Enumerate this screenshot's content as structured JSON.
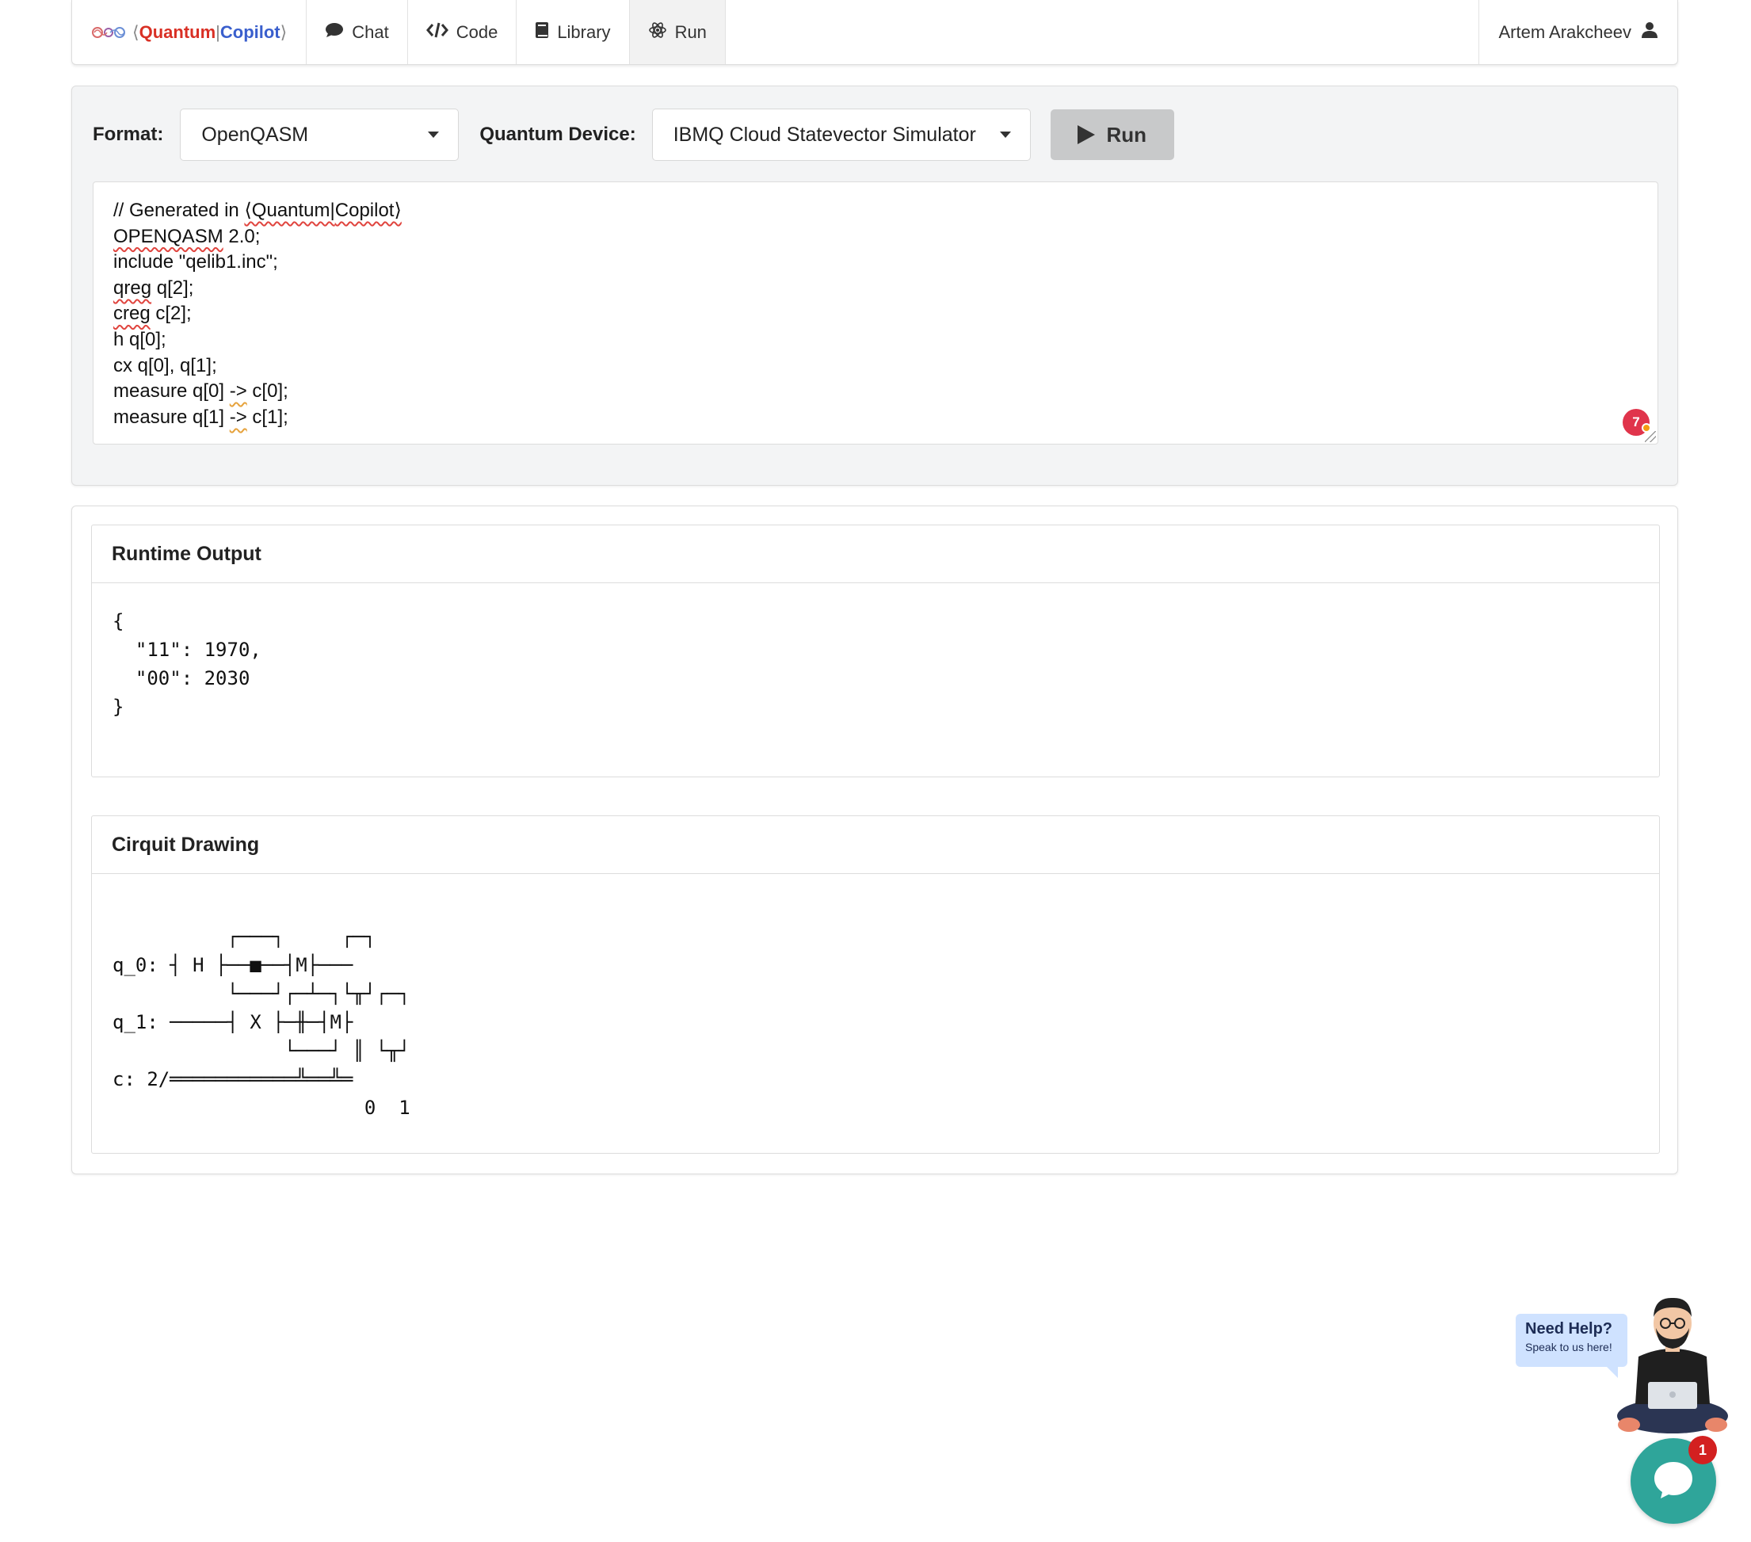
{
  "nav": {
    "brand_open": "⟨",
    "brand_quantum": "Quantum",
    "brand_sep": "|",
    "brand_copilot": "Copilot",
    "brand_close": "⟩",
    "items": [
      {
        "label": "Chat",
        "icon": "comment-icon"
      },
      {
        "label": "Code",
        "icon": "code-icon"
      },
      {
        "label": "Library",
        "icon": "book-icon"
      },
      {
        "label": "Run",
        "icon": "atom-icon",
        "active": true
      }
    ],
    "user_name": "Artem Arakcheev"
  },
  "toolbar": {
    "format_label": "Format:",
    "format_value": "OpenQASM",
    "device_label": "Quantum Device:",
    "device_value": "IBMQ Cloud Statevector Simulator",
    "run_label": "Run"
  },
  "editor": {
    "lines": [
      "// Generated in ⟨Quantum|Copilot⟩",
      "OPENQASM 2.0;",
      "include \"qelib1.inc\";",
      "qreg q[2];",
      "creg c[2];",
      "h q[0];",
      "cx q[0], q[1];",
      "measure q[0] -> c[0];",
      "measure q[1] -> c[1];"
    ],
    "error_count": "7"
  },
  "runtime": {
    "title": "Runtime Output",
    "output": "{\n  \"11\": 1970,\n  \"00\": 2030\n}"
  },
  "circuit": {
    "title": "Cirquit Drawing",
    "drawing": "          ┌───┐     ┌─┐   \nq_0: ┤ H ├──■──┤M├───\n          └───┘┌─┴─┐└╥┘┌─┐\nq_1: ─────┤ X ├─╫─┤M├\n               └───┘ ║ └╥┘\nc: 2/═══════════╩══╩═\n                      0  1 "
  },
  "help": {
    "title": "Need Help?",
    "subtitle": "Speak to us here!",
    "badge_count": "1"
  },
  "colors": {
    "brand_red": "#d93025",
    "brand_blue": "#3a5fcd",
    "error_badge": "#e0344b",
    "chat_teal": "#2fa59a"
  }
}
